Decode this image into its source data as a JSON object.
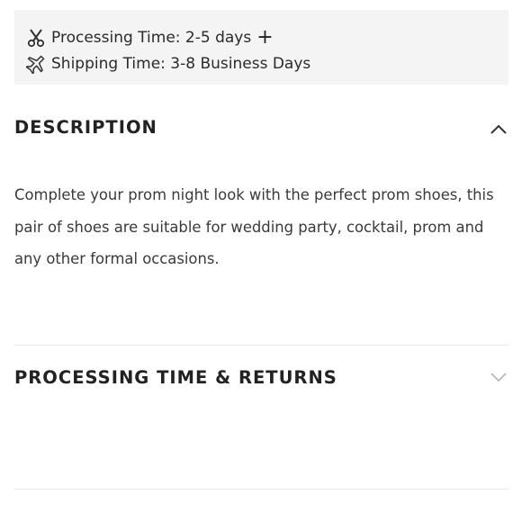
{
  "shipping_info": {
    "processing_label": "Processing Time: 2-5 days",
    "processing_icon": "scissors-icon",
    "expand_symbol": "+",
    "shipping_label": "Shipping Time: 3-8 Business Days",
    "shipping_icon": "airplane-icon"
  },
  "description": {
    "title": "DESCRIPTION",
    "state": "expanded",
    "text": "Complete your prom night look with the perfect prom shoes, this pair of shoes are suitable for wedding party, cocktail, prom and any other formal occasions."
  },
  "processing_returns": {
    "title": "PROCESSING TIME & RETURNS",
    "state": "collapsed"
  },
  "colors": {
    "panel_background": "#f4f4f4",
    "text": "#222222",
    "divider": "#e8e8e8"
  }
}
